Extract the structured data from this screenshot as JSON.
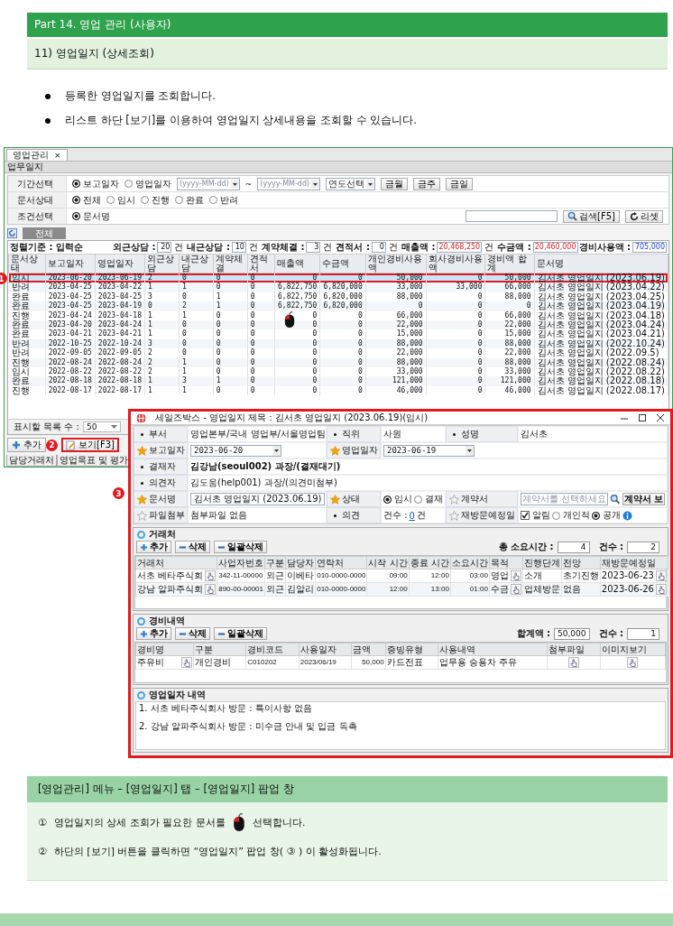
{
  "header": {
    "part": "Part 14. 영업 관리 (사용자)",
    "section": "11) 영업일지 (상세조회)"
  },
  "bullets": [
    "등록한 영업일지를 조회합니다.",
    "리스트 하단 [보기]를 이용하여 영업일지 상세내용을 조회할 수 있습니다."
  ],
  "main_window": {
    "tab": {
      "label": "영업관리",
      "close": "×"
    },
    "title": "업무일지",
    "filters": [
      {
        "kind": "period",
        "label": "기간선택",
        "radios": [
          {
            "label": "보고일자",
            "selected": true
          },
          {
            "label": "영업일자",
            "selected": false
          }
        ],
        "date_from": {
          "placeholder": "(yyyy-MM-dd)"
        },
        "separator": "~",
        "date_to": {
          "placeholder": "(yyyy-MM-dd)"
        },
        "year_select": "연도선택",
        "buttons": [
          "금월",
          "금주",
          "금일"
        ]
      },
      {
        "kind": "status",
        "label": "문서상태",
        "radios": [
          {
            "label": "전체",
            "selected": true
          },
          {
            "label": "임시",
            "selected": false
          },
          {
            "label": "진행",
            "selected": false
          },
          {
            "label": "완료",
            "selected": false
          },
          {
            "label": "반려",
            "selected": false
          }
        ]
      },
      {
        "kind": "condition",
        "label": "조건선택",
        "radios": [
          {
            "label": "문서명",
            "selected": true
          }
        ],
        "search_button": "검색[F5]",
        "reset_button": "리셋"
      }
    ],
    "list_tab": "전체",
    "summary": {
      "sort_label": "정렬기준 : 입력순",
      "fields": [
        {
          "kind": "count",
          "label": "외근상담 :",
          "value": "20",
          "unit": "건"
        },
        {
          "kind": "count",
          "label": "내근상담 :",
          "value": "10",
          "unit": "건"
        },
        {
          "kind": "count",
          "label": "계약체결 :",
          "value": "3",
          "unit": "건"
        },
        {
          "kind": "count",
          "label": "견적서 :",
          "value": "0",
          "unit": "건"
        },
        {
          "kind": "amount",
          "label": "매출액 :",
          "value": "20,468,250",
          "unit": "건"
        },
        {
          "kind": "amount",
          "label": "수금액 :",
          "value": "20,460,000"
        },
        {
          "kind": "expense",
          "label": "경비사용액 :",
          "value": "705,000"
        }
      ]
    },
    "table": {
      "callout": "1",
      "columns": [
        {
          "label": "문서상태",
          "kind": "text"
        },
        {
          "label": "보고일자",
          "kind": "date"
        },
        {
          "label": "영업일자",
          "kind": "date"
        },
        {
          "label": "외근상담",
          "kind": "count"
        },
        {
          "label": "내근상담",
          "kind": "count"
        },
        {
          "label": "계약체결",
          "kind": "count"
        },
        {
          "label": "견적서",
          "kind": "count"
        },
        {
          "label": "매출액",
          "kind": "amount"
        },
        {
          "label": "수금액",
          "kind": "amount"
        },
        {
          "label": "개인경비사용액",
          "kind": "amount"
        },
        {
          "label": "회사경비사용액",
          "kind": "amount"
        },
        {
          "label": "경비액 합계",
          "kind": "amount"
        },
        {
          "label": "문서명",
          "kind": "text"
        }
      ],
      "rows": [
        {
          "selected": true,
          "highlighted": true,
          "cells": [
            "임시",
            "2023-06-20",
            "2023-06-19",
            "2",
            "0",
            "0",
            "0",
            "0",
            "0",
            "50,000",
            "0",
            "50,000",
            "김서초 영업일지 (2023.06.19)"
          ]
        },
        {
          "selected": false,
          "highlighted": false,
          "cells": [
            "반려",
            "2023-04-25",
            "2023-04-22",
            "1",
            "1",
            "0",
            "0",
            "6,822,750",
            "6,820,000",
            "33,000",
            "33,000",
            "66,000",
            "김서초 영업일지 (2023.04.22)"
          ]
        },
        {
          "selected": false,
          "highlighted": false,
          "cells": [
            "완료",
            "2023-04-25",
            "2023-04-25",
            "3",
            "0",
            "1",
            "0",
            "6,822,750",
            "6,820,000",
            "88,000",
            "0",
            "88,000",
            "김서초 영업일지 (2023.04.25)"
          ]
        },
        {
          "selected": false,
          "highlighted": false,
          "cells": [
            "완료",
            "2023-04-25",
            "2023-04-19",
            "0",
            "2",
            "1",
            "0",
            "6,822,750",
            "6,820,000",
            "0",
            "0",
            "0",
            "김서초 영업일지 (2023.04.19)"
          ]
        },
        {
          "selected": false,
          "highlighted": false,
          "cells": [
            "진행",
            "2023-04-24",
            "2023-04-18",
            "1",
            "1",
            "0",
            "0",
            "0",
            "0",
            "66,000",
            "0",
            "66,000",
            "김서초 영업일지 (2023.04.18)"
          ]
        },
        {
          "selected": false,
          "highlighted": false,
          "cells": [
            "완료",
            "2023-04-20",
            "2023-04-24",
            "1",
            "0",
            "0",
            "0",
            "0",
            "0",
            "22,000",
            "0",
            "22,000",
            "김서초 영업일지 (2023.04.24)"
          ]
        },
        {
          "selected": false,
          "highlighted": false,
          "cells": [
            "완료",
            "2023-04-21",
            "2023-04-21",
            "1",
            "0",
            "0",
            "0",
            "0",
            "0",
            "15,000",
            "0",
            "15,000",
            "김서초 영업일지 (2023.04.21)"
          ]
        },
        {
          "selected": false,
          "highlighted": false,
          "cells": [
            "반려",
            "2022-10-25",
            "2022-10-24",
            "3",
            "0",
            "0",
            "0",
            "0",
            "0",
            "88,000",
            "0",
            "88,000",
            "김서초 영업일지 (2022.10.24)"
          ]
        },
        {
          "selected": false,
          "highlighted": false,
          "cells": [
            "반려",
            "2022-09-05",
            "2022-09-05",
            "2",
            "0",
            "0",
            "0",
            "0",
            "0",
            "22,000",
            "0",
            "22,000",
            "김서초 영업일지 (2022.09.5)"
          ]
        },
        {
          "selected": false,
          "highlighted": false,
          "cells": [
            "진행",
            "2022-08-24",
            "2022-08-24",
            "2",
            "1",
            "0",
            "0",
            "0",
            "0",
            "88,000",
            "0",
            "88,000",
            "김서초 영업일지 (2022.08.24)"
          ]
        },
        {
          "selected": false,
          "highlighted": false,
          "cells": [
            "임시",
            "2022-08-22",
            "2022-08-22",
            "2",
            "1",
            "0",
            "0",
            "0",
            "0",
            "33,000",
            "0",
            "33,000",
            "김서초 영업일지 (2022.08.22)"
          ]
        },
        {
          "selected": false,
          "highlighted": false,
          "cells": [
            "완료",
            "2022-08-18",
            "2022-08-18",
            "1",
            "3",
            "1",
            "0",
            "0",
            "0",
            "121,000",
            "0",
            "121,000",
            "김서초 영업일지 (2022.08.18)"
          ]
        },
        {
          "selected": false,
          "highlighted": false,
          "cells": [
            "진행",
            "2022-08-17",
            "2022-08-17",
            "1",
            "1",
            "0",
            "0",
            "0",
            "0",
            "46,000",
            "0",
            "46,000",
            "김서초 영업일지 (2022.08.17)"
          ]
        }
      ]
    },
    "page_size": {
      "label": "표시할 목록 수 :",
      "value": "50"
    },
    "actions": [
      {
        "kind": "add",
        "label": "추가",
        "highlighted": false
      },
      {
        "kind": "view",
        "label": "보기[F3]",
        "highlighted": true,
        "callout": "2"
      }
    ],
    "bottom_tabs": [
      "담당거래처",
      "영업목표 및 평가"
    ]
  },
  "popup": {
    "callout": "3",
    "title": "세일즈박스 - 영업일지 제목 : 김서초 영업일지 (2023.06.19)(임시)",
    "form_rows": [
      [
        {
          "label": {
            "kind": "dot",
            "text": "부서"
          },
          "kind": "text",
          "value": "영업본부/국내 영업부/서울영업팀"
        },
        {
          "label": {
            "kind": "dot",
            "text": "직위"
          },
          "kind": "text",
          "value": "사원"
        },
        {
          "label": {
            "kind": "dot",
            "text": "성명"
          },
          "kind": "text",
          "value": "김서초"
        }
      ],
      [
        {
          "label": {
            "kind": "star",
            "text": "보고일자"
          },
          "kind": "date",
          "value": "2023-06-20"
        },
        {
          "label": {
            "kind": "star",
            "text": "영업일자"
          },
          "kind": "date",
          "value": "2023-06-19"
        }
      ],
      [
        {
          "label": {
            "kind": "dot",
            "text": "결재자"
          },
          "kind": "bold",
          "value": "김강남(seoul002) 과장/(결재대기)"
        }
      ],
      [
        {
          "label": {
            "kind": "dot",
            "text": "의견자"
          },
          "kind": "text",
          "value": "김도움(help001) 과장/(의견미첨부)"
        }
      ],
      [
        {
          "label": {
            "kind": "star",
            "text": "문서명"
          },
          "kind": "input",
          "value": "김서초 영업일지 (2023.06.19)"
        },
        {
          "label": {
            "kind": "star",
            "text": "상태"
          },
          "kind": "radios",
          "radios": [
            {
              "label": "임시",
              "selected": true
            },
            {
              "label": "결재",
              "selected": false
            }
          ]
        },
        {
          "label": {
            "kind": "star_outline",
            "text": "계약서"
          },
          "kind": "contract",
          "placeholder": "계약서를 선택하세요",
          "button": "계약서 보"
        }
      ],
      [
        {
          "label": {
            "kind": "star_outline",
            "text": "파일첨부"
          },
          "kind": "text",
          "value": "첨부파일 없음"
        },
        {
          "label": {
            "kind": "dot",
            "text": "의견"
          },
          "kind": "count",
          "prefix": "건수 :",
          "count": "0",
          "suffix": "건"
        },
        {
          "label": {
            "kind": "star_outline",
            "text": "재방문예정일"
          },
          "kind": "options",
          "checkbox": {
            "label": "알림",
            "checked": true
          },
          "radios": [
            {
              "label": "개인적",
              "selected": false
            },
            {
              "label": "공개",
              "selected": true
            }
          ]
        }
      ]
    ],
    "partners": {
      "title": "거래처",
      "buttons": [
        {
          "kind": "add",
          "label": "추가"
        },
        {
          "kind": "remove",
          "label": "삭제"
        },
        {
          "kind": "remove",
          "label": "일괄삭제"
        }
      ],
      "totals": [
        {
          "label": "총 소요시간 :",
          "value": "4"
        },
        {
          "label": "건수 :",
          "value": "2"
        }
      ],
      "columns": [
        {
          "label": "거래처",
          "kind": "picker"
        },
        {
          "label": "사업자번호",
          "kind": "latin"
        },
        {
          "label": "구분",
          "kind": "text"
        },
        {
          "label": "담당자",
          "kind": "text"
        },
        {
          "label": "연락처",
          "kind": "latin"
        },
        {
          "label": "시작 시간",
          "kind": "right"
        },
        {
          "label": "종료 시간",
          "kind": "right"
        },
        {
          "label": "소요시간",
          "kind": "right"
        },
        {
          "label": "목적",
          "kind": "picker"
        },
        {
          "label": "진행단계",
          "kind": "text"
        },
        {
          "label": "전망",
          "kind": "text"
        },
        {
          "label": "재방문예정일",
          "kind": "picker"
        }
      ],
      "rows": [
        [
          "서초 베타주식회",
          "342-11-00000",
          "외근",
          "이베타",
          "010-0000-0000",
          "09:00",
          "12:00",
          "03:00",
          "영업",
          "소개",
          "초기진행",
          "2023-06-23"
        ],
        [
          "강남 알파주식회",
          "890-00-00001",
          "외근",
          "김알리",
          "010-0000-0000",
          "12:00",
          "13:00",
          "01:00",
          "수금",
          "업체방문",
          "없음",
          "2023-06-26"
        ]
      ]
    },
    "expenses": {
      "title": "경비내역",
      "buttons": [
        {
          "kind": "add",
          "label": "추가"
        },
        {
          "kind": "remove",
          "label": "삭제"
        },
        {
          "kind": "remove",
          "label": "일괄삭제"
        }
      ],
      "totals": [
        {
          "label": "합계액 :",
          "value": "50,000"
        },
        {
          "label": "건수 :",
          "value": "1"
        }
      ],
      "columns": [
        {
          "label": "경비명",
          "kind": "picker"
        },
        {
          "label": "구분",
          "kind": "text"
        },
        {
          "label": "경비코드",
          "kind": "latin"
        },
        {
          "label": "사용일자",
          "kind": "latin"
        },
        {
          "label": "금액",
          "kind": "right"
        },
        {
          "label": "증빙유형",
          "kind": "text"
        },
        {
          "label": "사용내역",
          "kind": "text"
        },
        {
          "label": "첨부파일",
          "kind": "button"
        },
        {
          "label": "이미지보기",
          "kind": "button"
        }
      ],
      "rows": [
        [
          "주유비",
          "개인경비",
          "C010202",
          "2023/06/19",
          "50,000",
          "카드전표",
          "업무용 승용차 주유"
        ]
      ]
    },
    "notes": {
      "title": "영업일자 내역",
      "lines": [
        "1. 서초 베타주식회사 방문 : 특이사항 없음",
        "2. 강남 알파주식회사 방문 : 미수금 안내 및 입금 독촉"
      ]
    }
  },
  "caption": {
    "title": "[영업관리] 메뉴 – [영업일지] 탭 – [영업일지] 팝업 창",
    "steps": [
      {
        "number": "①",
        "parts": [
          {
            "kind": "text",
            "text": "영업일지의 상세 조회가 필요한 문서를"
          },
          {
            "kind": "mouse"
          },
          {
            "kind": "text",
            "text": "선택합니다."
          }
        ]
      },
      {
        "number": "②",
        "parts": [
          {
            "kind": "text",
            "text": "하단의 [보기] 버튼을 클릭하면 “영업일지” 팝업 창( ③ ) 이 활성화됩니다."
          }
        ]
      }
    ]
  }
}
